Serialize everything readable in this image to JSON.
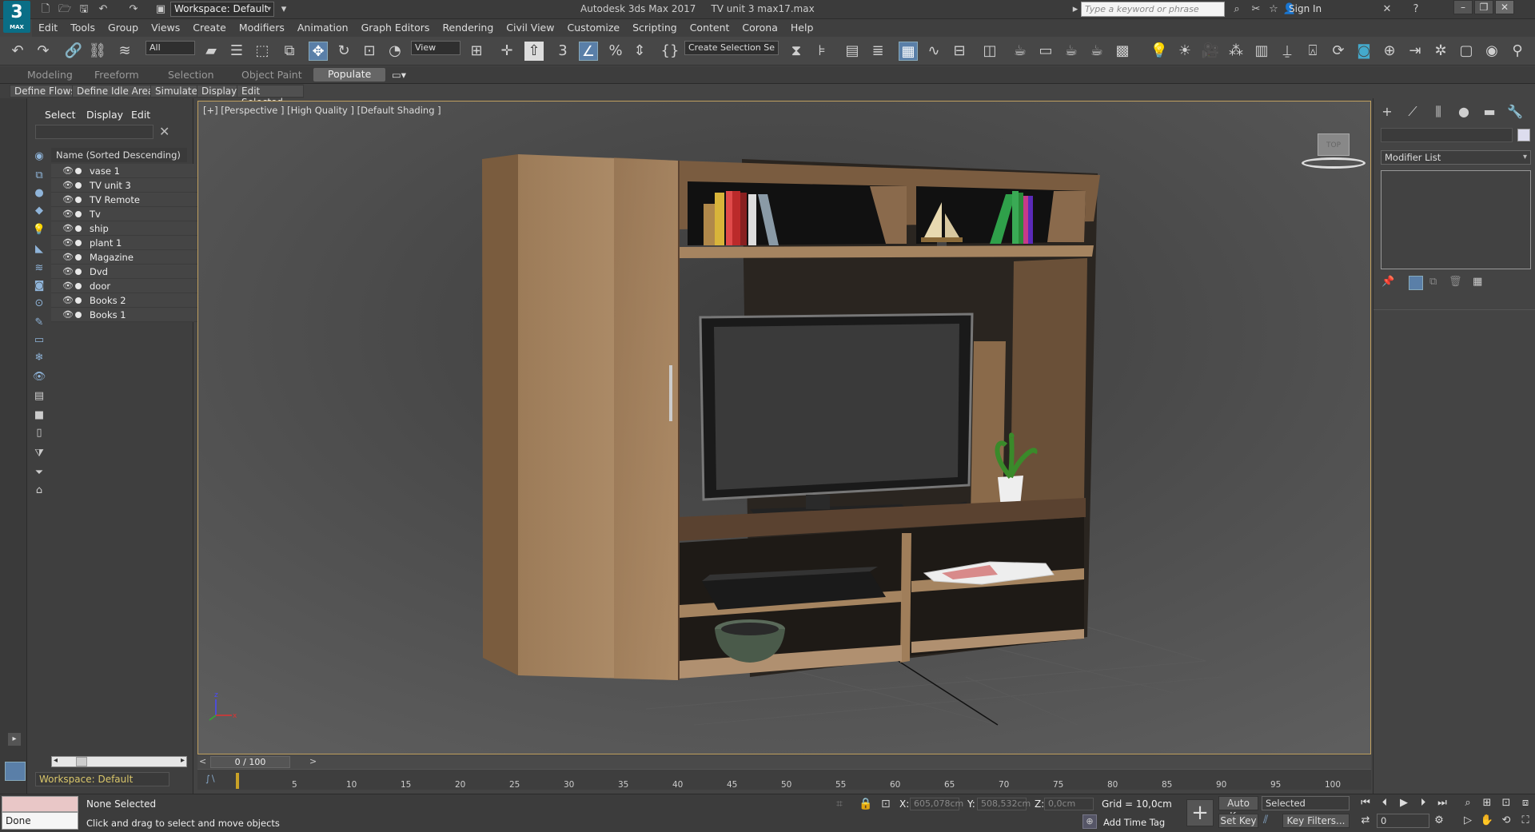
{
  "app": {
    "logo": "3",
    "logo_sub": "MAX",
    "title": "Autodesk 3ds Max 2017",
    "file": "TV unit 3 max17.max",
    "workspace": "Workspace: Default",
    "search_placeholder": "Type a keyword or phrase",
    "sign_in": "Sign In"
  },
  "menu": [
    "Edit",
    "Tools",
    "Group",
    "Views",
    "Create",
    "Modifiers",
    "Animation",
    "Graph Editors",
    "Rendering",
    "Civil View",
    "Customize",
    "Scripting",
    "Content",
    "Corona",
    "Help"
  ],
  "toolbar": {
    "filter": "All",
    "view_combo": "View",
    "selection_set": "Create Selection Se",
    "snap_label": "3"
  },
  "ribbon": {
    "tabs": [
      "Modeling",
      "Freeform",
      "Selection",
      "Object Paint",
      "Populate"
    ],
    "active": "Populate",
    "buttons": [
      "Define Flows",
      "Define Idle Areas",
      "Simulate",
      "Display",
      "Edit Selected"
    ]
  },
  "scene_explorer": {
    "menus": [
      "Select",
      "Display",
      "Edit"
    ],
    "header": "Name (Sorted Descending)",
    "objects": [
      "vase 1",
      "TV unit 3",
      "TV Remote",
      "Tv",
      "ship",
      "plant 1",
      "Magazine",
      "Dvd",
      "door",
      "Books 2",
      "Books 1"
    ],
    "workspace": "Workspace: Default"
  },
  "viewport": {
    "label": "[+] [Perspective ] [High Quality ] [Default Shading ]",
    "cube_label": "TOP"
  },
  "command_panel": {
    "modifier_list": "Modifier List"
  },
  "timeline": {
    "frame": "0 / 100",
    "ticks": [
      "5",
      "10",
      "15",
      "20",
      "25",
      "30",
      "35",
      "40",
      "45",
      "50",
      "55",
      "60",
      "65",
      "70",
      "75",
      "80",
      "85",
      "90",
      "95",
      "100"
    ]
  },
  "status": {
    "listener": "Done",
    "selection": "None Selected",
    "prompt": "Click and drag to select and move objects",
    "x_label": "X:",
    "x_value": "605,078cm",
    "y_label": "Y:",
    "y_value": "508,532cm",
    "z_label": "Z:",
    "z_value": "0,0cm",
    "grid": "Grid = 10,0cm",
    "add_time_tag": "Add Time Tag",
    "auto_key": "Auto Key",
    "set_key": "Set Key",
    "key_mode": "Selected",
    "key_filters": "Key Filters...",
    "current_frame": "0"
  },
  "colors": {
    "viewport_border": "#c0a060",
    "active_tool": "#5a7fa8",
    "wood": "#b08a62"
  }
}
